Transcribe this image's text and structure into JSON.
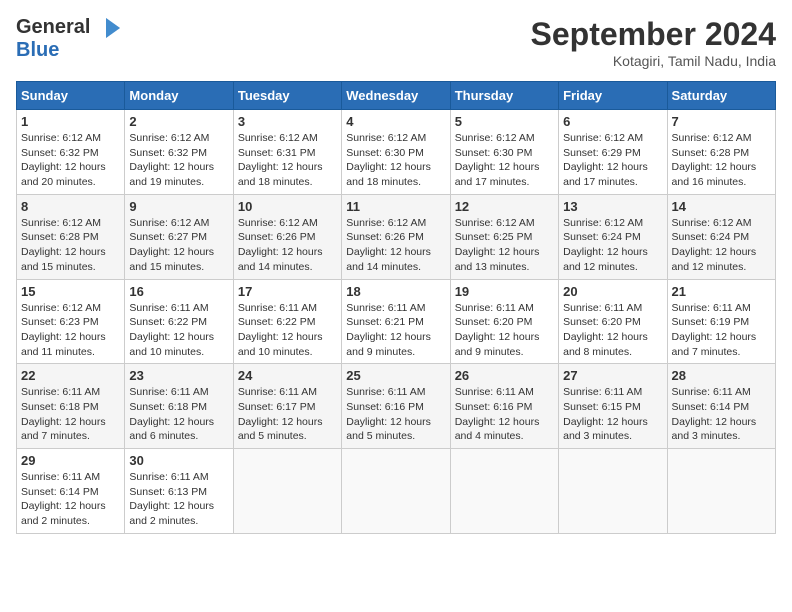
{
  "logo": {
    "general": "General",
    "blue": "Blue"
  },
  "header": {
    "month": "September 2024",
    "location": "Kotagiri, Tamil Nadu, India"
  },
  "days_of_week": [
    "Sunday",
    "Monday",
    "Tuesday",
    "Wednesday",
    "Thursday",
    "Friday",
    "Saturday"
  ],
  "weeks": [
    [
      {
        "day": "1",
        "sunrise": "6:12 AM",
        "sunset": "6:32 PM",
        "daylight": "12 hours and 20 minutes."
      },
      {
        "day": "2",
        "sunrise": "6:12 AM",
        "sunset": "6:32 PM",
        "daylight": "12 hours and 19 minutes."
      },
      {
        "day": "3",
        "sunrise": "6:12 AM",
        "sunset": "6:31 PM",
        "daylight": "12 hours and 18 minutes."
      },
      {
        "day": "4",
        "sunrise": "6:12 AM",
        "sunset": "6:30 PM",
        "daylight": "12 hours and 18 minutes."
      },
      {
        "day": "5",
        "sunrise": "6:12 AM",
        "sunset": "6:30 PM",
        "daylight": "12 hours and 17 minutes."
      },
      {
        "day": "6",
        "sunrise": "6:12 AM",
        "sunset": "6:29 PM",
        "daylight": "12 hours and 17 minutes."
      },
      {
        "day": "7",
        "sunrise": "6:12 AM",
        "sunset": "6:28 PM",
        "daylight": "12 hours and 16 minutes."
      }
    ],
    [
      {
        "day": "8",
        "sunrise": "6:12 AM",
        "sunset": "6:28 PM",
        "daylight": "12 hours and 15 minutes."
      },
      {
        "day": "9",
        "sunrise": "6:12 AM",
        "sunset": "6:27 PM",
        "daylight": "12 hours and 15 minutes."
      },
      {
        "day": "10",
        "sunrise": "6:12 AM",
        "sunset": "6:26 PM",
        "daylight": "12 hours and 14 minutes."
      },
      {
        "day": "11",
        "sunrise": "6:12 AM",
        "sunset": "6:26 PM",
        "daylight": "12 hours and 14 minutes."
      },
      {
        "day": "12",
        "sunrise": "6:12 AM",
        "sunset": "6:25 PM",
        "daylight": "12 hours and 13 minutes."
      },
      {
        "day": "13",
        "sunrise": "6:12 AM",
        "sunset": "6:24 PM",
        "daylight": "12 hours and 12 minutes."
      },
      {
        "day": "14",
        "sunrise": "6:12 AM",
        "sunset": "6:24 PM",
        "daylight": "12 hours and 12 minutes."
      }
    ],
    [
      {
        "day": "15",
        "sunrise": "6:12 AM",
        "sunset": "6:23 PM",
        "daylight": "12 hours and 11 minutes."
      },
      {
        "day": "16",
        "sunrise": "6:11 AM",
        "sunset": "6:22 PM",
        "daylight": "12 hours and 10 minutes."
      },
      {
        "day": "17",
        "sunrise": "6:11 AM",
        "sunset": "6:22 PM",
        "daylight": "12 hours and 10 minutes."
      },
      {
        "day": "18",
        "sunrise": "6:11 AM",
        "sunset": "6:21 PM",
        "daylight": "12 hours and 9 minutes."
      },
      {
        "day": "19",
        "sunrise": "6:11 AM",
        "sunset": "6:20 PM",
        "daylight": "12 hours and 9 minutes."
      },
      {
        "day": "20",
        "sunrise": "6:11 AM",
        "sunset": "6:20 PM",
        "daylight": "12 hours and 8 minutes."
      },
      {
        "day": "21",
        "sunrise": "6:11 AM",
        "sunset": "6:19 PM",
        "daylight": "12 hours and 7 minutes."
      }
    ],
    [
      {
        "day": "22",
        "sunrise": "6:11 AM",
        "sunset": "6:18 PM",
        "daylight": "12 hours and 7 minutes."
      },
      {
        "day": "23",
        "sunrise": "6:11 AM",
        "sunset": "6:18 PM",
        "daylight": "12 hours and 6 minutes."
      },
      {
        "day": "24",
        "sunrise": "6:11 AM",
        "sunset": "6:17 PM",
        "daylight": "12 hours and 5 minutes."
      },
      {
        "day": "25",
        "sunrise": "6:11 AM",
        "sunset": "6:16 PM",
        "daylight": "12 hours and 5 minutes."
      },
      {
        "day": "26",
        "sunrise": "6:11 AM",
        "sunset": "6:16 PM",
        "daylight": "12 hours and 4 minutes."
      },
      {
        "day": "27",
        "sunrise": "6:11 AM",
        "sunset": "6:15 PM",
        "daylight": "12 hours and 3 minutes."
      },
      {
        "day": "28",
        "sunrise": "6:11 AM",
        "sunset": "6:14 PM",
        "daylight": "12 hours and 3 minutes."
      }
    ],
    [
      {
        "day": "29",
        "sunrise": "6:11 AM",
        "sunset": "6:14 PM",
        "daylight": "12 hours and 2 minutes."
      },
      {
        "day": "30",
        "sunrise": "6:11 AM",
        "sunset": "6:13 PM",
        "daylight": "12 hours and 2 minutes."
      },
      null,
      null,
      null,
      null,
      null
    ]
  ]
}
